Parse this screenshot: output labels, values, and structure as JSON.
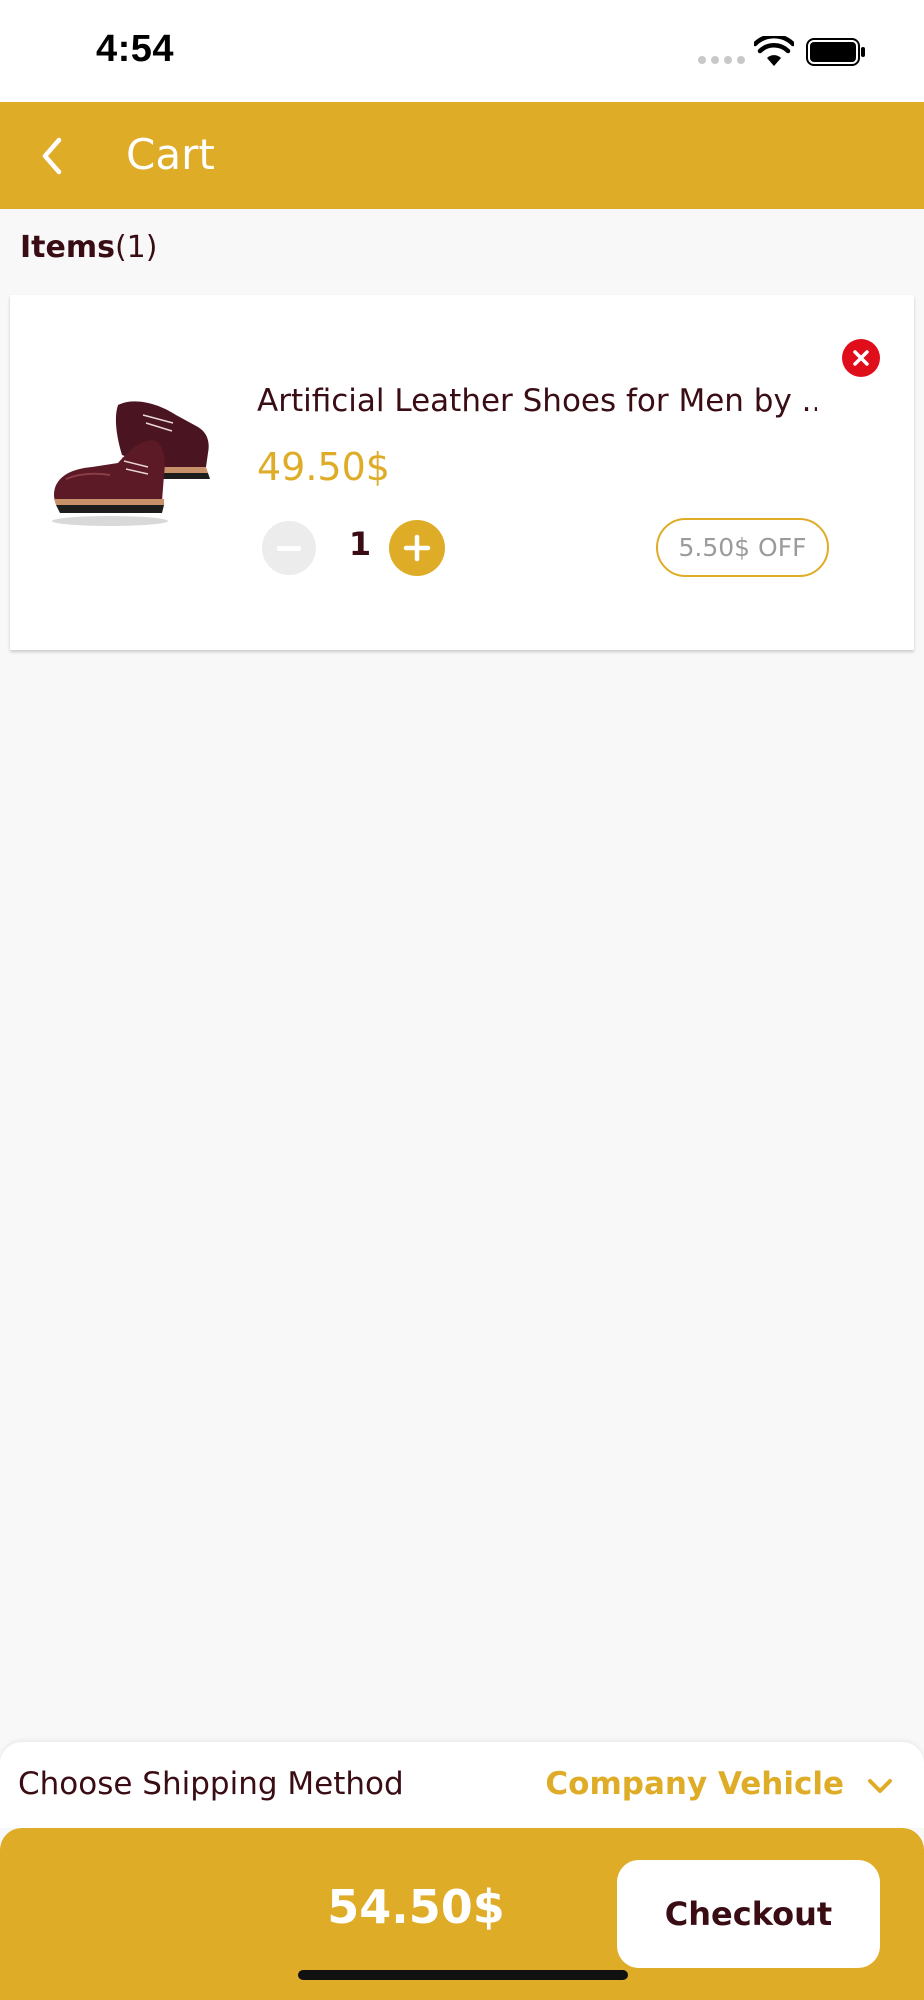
{
  "status_bar": {
    "time": "4:54"
  },
  "app_bar": {
    "title": "Cart",
    "back_icon": "chevron-left-icon"
  },
  "cart": {
    "items_label": "Items",
    "items_count": "(1)",
    "items": [
      {
        "name": "Artificial Leather Shoes for Men by ...",
        "price": "49.50$",
        "quantity": "1",
        "discount": "5.50$ OFF",
        "image": "leather-shoes-image"
      }
    ]
  },
  "shipping": {
    "label": "Choose Shipping Method",
    "value": "Company Vehicle"
  },
  "footer": {
    "total": "54.50$",
    "checkout_label": "Checkout"
  },
  "colors": {
    "accent": "#dfac28",
    "text_dark": "#3a0d15",
    "remove": "#e00d1b",
    "background": "#f8f8f8"
  }
}
